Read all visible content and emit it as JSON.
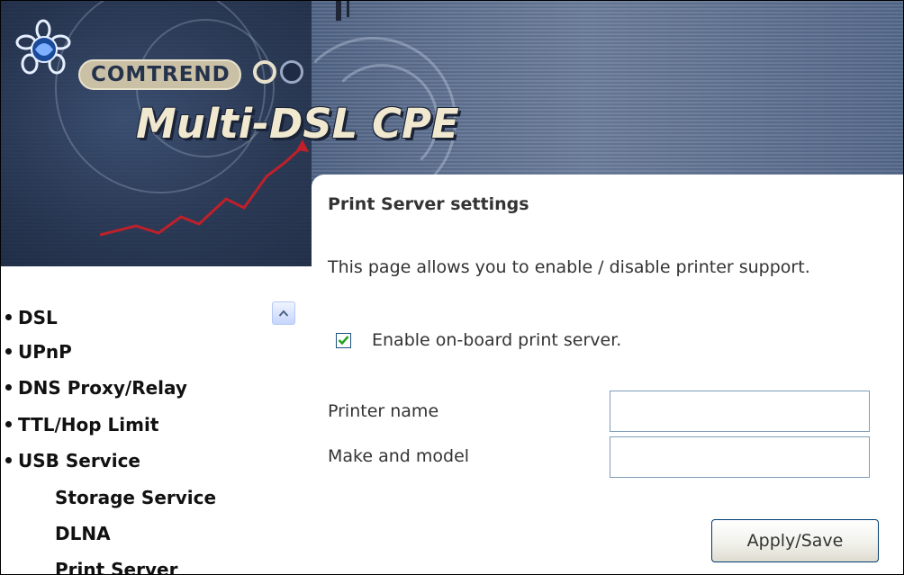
{
  "header": {
    "brand": "COMTREND",
    "product_title": "Multi-DSL CPE"
  },
  "nav": {
    "items": [
      {
        "label": "DSL"
      },
      {
        "label": "UPnP"
      },
      {
        "label": "DNS Proxy/Relay"
      },
      {
        "label": "TTL/Hop Limit"
      },
      {
        "label": "USB Service"
      }
    ],
    "sub_items": [
      {
        "label": "Storage Service"
      },
      {
        "label": "DLNA"
      },
      {
        "label": "Print Server",
        "selected": true
      }
    ]
  },
  "main": {
    "title": "Print Server settings",
    "description": "This page allows you to enable / disable printer support.",
    "enable_checkbox": {
      "label": "Enable on-board print server.",
      "checked": true
    },
    "fields": [
      {
        "label": "Printer name",
        "value": ""
      },
      {
        "label": "Make and model",
        "value": ""
      }
    ],
    "apply_button": "Apply/Save"
  },
  "colors": {
    "banner": "#44587a",
    "title_text": "#f1e9cf",
    "checkmark": "#21a121",
    "button_border": "#003c74"
  }
}
